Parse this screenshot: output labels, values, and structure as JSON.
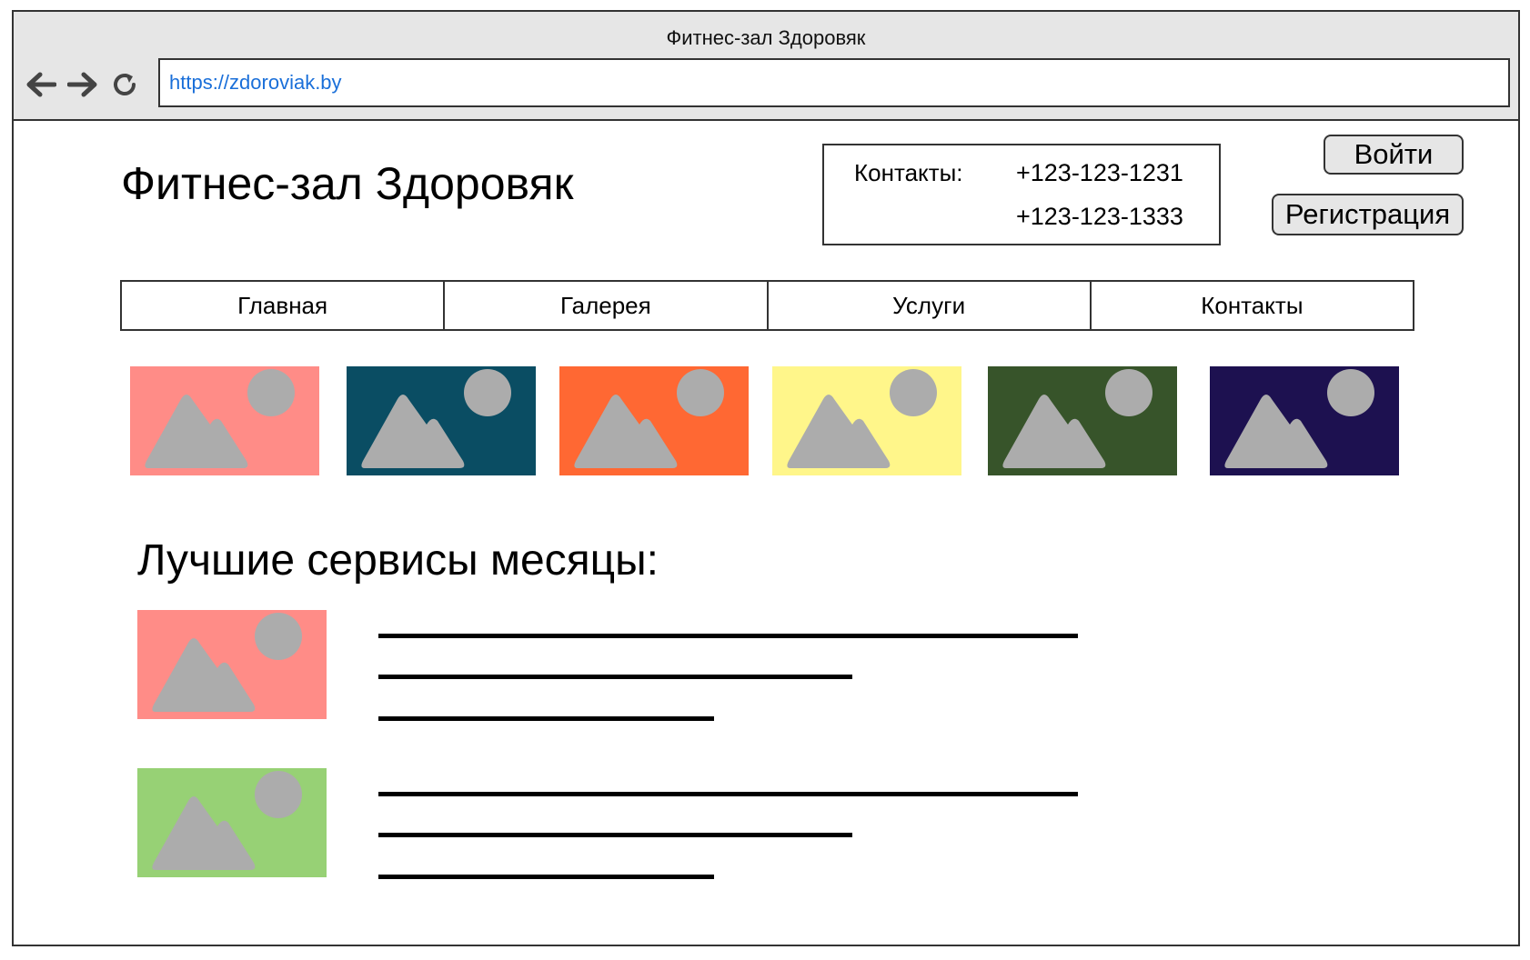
{
  "browser": {
    "window_title": "Фитнес-зал Здоровяк",
    "url": "https://zdoroviak.by",
    "icons": [
      "back-arrow-icon",
      "forward-arrow-icon",
      "reload-icon"
    ]
  },
  "header": {
    "site_title": "Фитнес-зал Здоровяк",
    "contacts_label": "Контакты:",
    "phones": [
      "+123-123-1231",
      "+123-123-1333"
    ],
    "login_label": "Войти",
    "register_label": "Регистрация"
  },
  "menu": {
    "items": [
      {
        "label": "Главная"
      },
      {
        "label": "Галерея"
      },
      {
        "label": "Услуги"
      },
      {
        "label": "Контакты"
      }
    ]
  },
  "gallery": {
    "placeholder_icon": "image-placeholder-icon",
    "images": [
      {
        "color": "#FF8C87"
      },
      {
        "color": "#0A4D63"
      },
      {
        "color": "#FF6833"
      },
      {
        "color": "#FFF68A"
      },
      {
        "color": "#37542A"
      },
      {
        "color": "#1D1150"
      }
    ]
  },
  "services": {
    "title": "Лучшие сервисы месяцы:",
    "items": [
      {
        "image_color": "#FF8C87",
        "text_lines": 3
      },
      {
        "image_color": "#97D175",
        "text_lines": 3
      }
    ]
  },
  "colors": {
    "url_text": "#1A6FD9",
    "chrome_bg": "#E6E6E6",
    "placeholder_shape": "#ACACAC"
  }
}
